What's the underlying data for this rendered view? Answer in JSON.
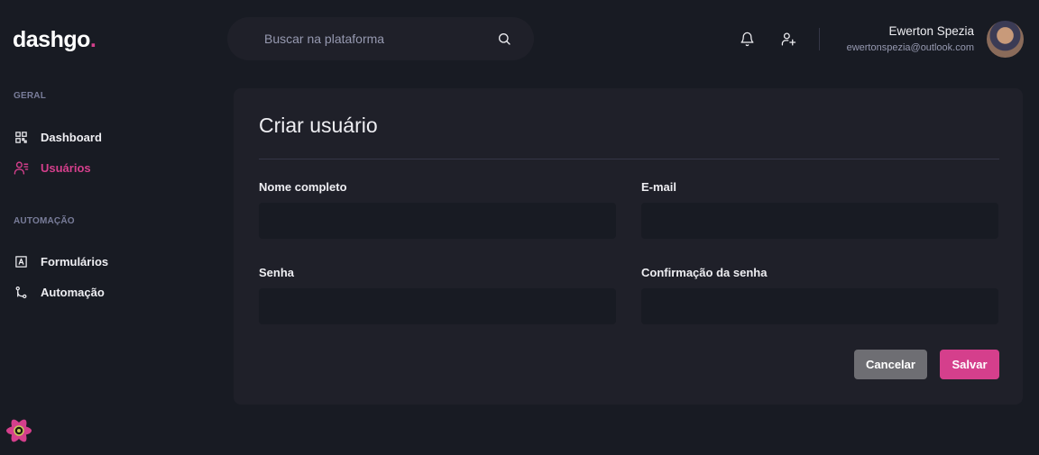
{
  "app": {
    "logo_text": "dashgo",
    "logo_dot": "."
  },
  "search": {
    "placeholder": "Buscar na plataforma",
    "icon": "search-icon"
  },
  "header": {
    "icons": [
      "bell-icon",
      "user-add-icon"
    ]
  },
  "profile": {
    "name": "Ewerton Spezia",
    "email": "ewertonspezia@outlook.com"
  },
  "sidebar": {
    "sections": [
      {
        "title": "GERAL",
        "items": [
          {
            "label": "Dashboard",
            "icon": "dashboard-icon",
            "active": false
          },
          {
            "label": "Usuários",
            "icon": "users-icon",
            "active": true
          }
        ]
      },
      {
        "title": "AUTOMAÇÃO",
        "items": [
          {
            "label": "Formulários",
            "icon": "form-icon",
            "active": false
          },
          {
            "label": "Automação",
            "icon": "git-merge-icon",
            "active": false
          }
        ]
      }
    ]
  },
  "form": {
    "title": "Criar usuário",
    "fields": {
      "name": {
        "label": "Nome completo",
        "value": ""
      },
      "email": {
        "label": "E-mail",
        "value": ""
      },
      "password": {
        "label": "Senha",
        "value": ""
      },
      "password_confirmation": {
        "label": "Confirmação da senha",
        "value": ""
      }
    },
    "cancel_label": "Cancelar",
    "save_label": "Salvar"
  },
  "colors": {
    "background": "#181B23",
    "card": "#1F2029",
    "accent": "#D53F8C",
    "muted": "#797D9A",
    "cancel": "#6E6E73"
  }
}
